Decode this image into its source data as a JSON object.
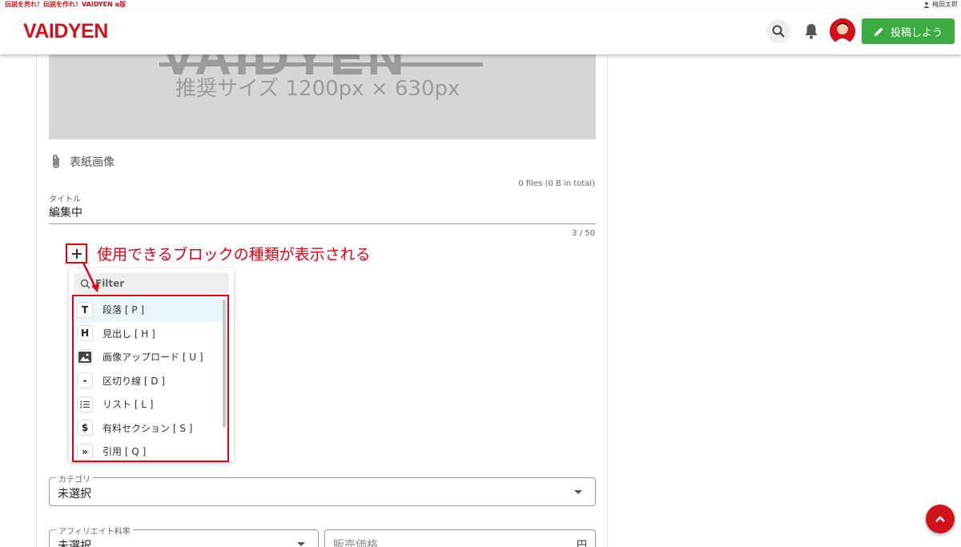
{
  "top": {
    "tagline": "伝説を売れ！伝説を作れ！VAIDYEN α版",
    "user_name": "梅田太郎"
  },
  "header": {
    "logo": "VAIDYEN",
    "post_button": "投稿しよう"
  },
  "cover": {
    "logo_text": "VAIDYEN",
    "size_text": "推奨サイズ 1200px × 630px"
  },
  "attach": {
    "label": "表紙画像",
    "files": "0 files (0 B in total)"
  },
  "title_field": {
    "label": "タイトル",
    "value": "編集中",
    "counter": "3 / 50"
  },
  "annotation": "使用できるブロックの種類が表示される",
  "menu": {
    "filter_placeholder": "Filter",
    "items": [
      {
        "icon": "T",
        "label": "段落 [ P ]"
      },
      {
        "icon": "H",
        "label": "見出し [ H ]"
      },
      {
        "icon": "image",
        "label": "画像アップロード [ U ]"
      },
      {
        "icon": "-",
        "label": "区切り線 [ D ]"
      },
      {
        "icon": "list",
        "label": "リスト [ L ]"
      },
      {
        "icon": "$",
        "label": "有料セクション [ S ]"
      },
      {
        "icon": "»",
        "label": "引用 [ Q ]"
      }
    ]
  },
  "category": {
    "legend": "カテゴリ",
    "value": "未選択"
  },
  "affiliate": {
    "legend": "アフィリエイト料率",
    "value": "未選択"
  },
  "price": {
    "placeholder": "販売価格",
    "unit": "円"
  },
  "colors": {
    "brand_red": "#d0121b",
    "post_green": "#3cab42",
    "annotation_red": "#e60012"
  }
}
